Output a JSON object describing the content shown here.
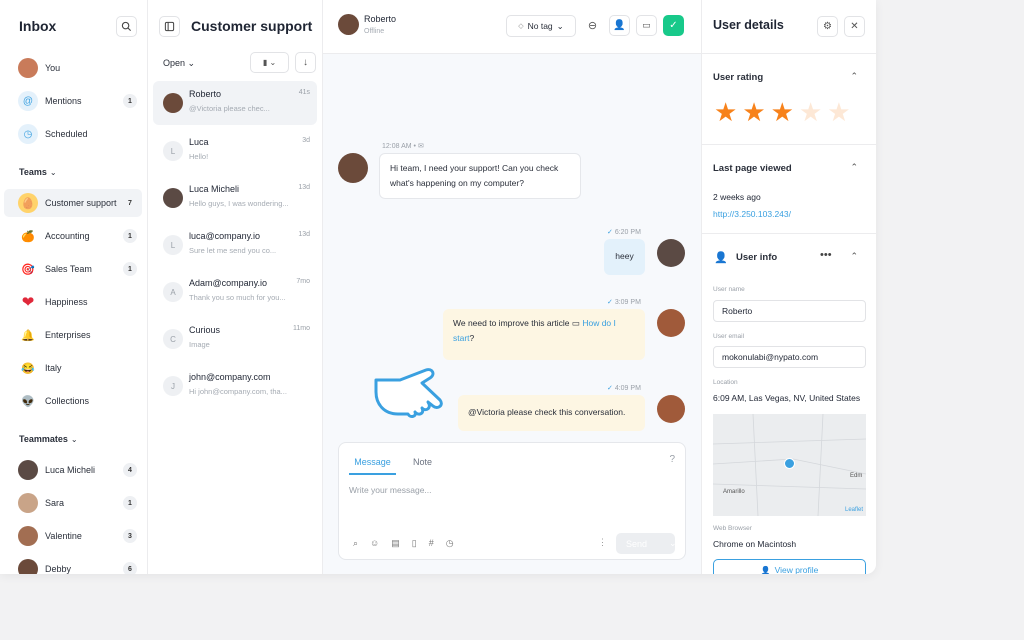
{
  "inbox": {
    "title": "Inbox",
    "items": [
      {
        "label": "You",
        "count": ""
      },
      {
        "label": "Mentions",
        "count": "1"
      },
      {
        "label": "Scheduled",
        "count": ""
      }
    ],
    "teams_label": "Teams",
    "teams": [
      {
        "label": "Customer support",
        "count": "7",
        "icon": "🥚"
      },
      {
        "label": "Accounting",
        "count": "1",
        "icon": "🍊"
      },
      {
        "label": "Sales Team",
        "count": "1",
        "icon": "🎯"
      },
      {
        "label": "Happiness",
        "count": "",
        "icon": "❤"
      },
      {
        "label": "Enterprises",
        "count": "",
        "icon": "🔔"
      },
      {
        "label": "Italy",
        "count": "",
        "icon": "😂"
      },
      {
        "label": "Collections",
        "count": "",
        "icon": "👽"
      }
    ],
    "teammates_label": "Teammates",
    "teammates": [
      {
        "label": "Luca Micheli",
        "count": "4"
      },
      {
        "label": "Sara",
        "count": "1"
      },
      {
        "label": "Valentine",
        "count": "3"
      },
      {
        "label": "Debby",
        "count": "6"
      }
    ]
  },
  "conversations": {
    "title": "Customer support",
    "filter": "Open",
    "items": [
      {
        "name": "Roberto",
        "time": "41s",
        "preview": "@Victoria please chec...",
        "initial": ""
      },
      {
        "name": "Luca",
        "time": "3d",
        "preview": "Hello!",
        "initial": "L"
      },
      {
        "name": "Luca Micheli",
        "time": "13d",
        "preview": "Hello guys, I was wondering...",
        "initial": ""
      },
      {
        "name": "luca@company.io",
        "time": "13d",
        "preview": "Sure let me send you co...",
        "initial": "L"
      },
      {
        "name": "Adam@company.io",
        "time": "7mo",
        "preview": "Thank you so much for you...",
        "initial": "A"
      },
      {
        "name": "Curious",
        "time": "11mo",
        "preview": "Image",
        "initial": "C"
      },
      {
        "name": "john@company.com",
        "time": "",
        "preview": "Hi john@company.com, tha...",
        "initial": "J"
      }
    ]
  },
  "chat": {
    "contact_name": "Roberto",
    "contact_status": "Offline",
    "tag_label": "No tag",
    "messages": [
      {
        "time": "12:08 AM •",
        "text": "Hi team, I need your support! Can you check what's happening on my computer?"
      },
      {
        "time": "6:20 PM",
        "text": "heey"
      },
      {
        "time": "3:09 PM",
        "text_a": "We need to improve this article",
        "link": "How do I start",
        "text_b": "?"
      },
      {
        "time": "4:09 PM",
        "text": "@Victoria please check this conversation."
      }
    ],
    "composer": {
      "tab_message": "Message",
      "tab_note": "Note",
      "placeholder": "Write your message...",
      "send_label": "Send"
    }
  },
  "details": {
    "title": "User details",
    "rating_label": "User rating",
    "rating": 3,
    "rating_max": 5,
    "last_page_label": "Last page viewed",
    "last_page_when": "2 weeks ago",
    "last_page_url": "http://3.250.103.243/",
    "user_info_label": "User info",
    "username_label": "User name",
    "username": "Roberto",
    "email_label": "User email",
    "email": "mokonulabi@nypato.com",
    "location_label": "Location",
    "location": "6:09 AM, Las Vegas, NV, United States",
    "map_city_1": "Amarillo",
    "map_city_2": "Edm",
    "map_attribution": "Leaflet",
    "browser_label": "Web Browser",
    "browser": "Chrome on Macintosh",
    "view_profile": "View profile"
  },
  "colors": {
    "accent": "#3aa0e0",
    "confirm": "#18c98a",
    "star": "#f7821b"
  }
}
